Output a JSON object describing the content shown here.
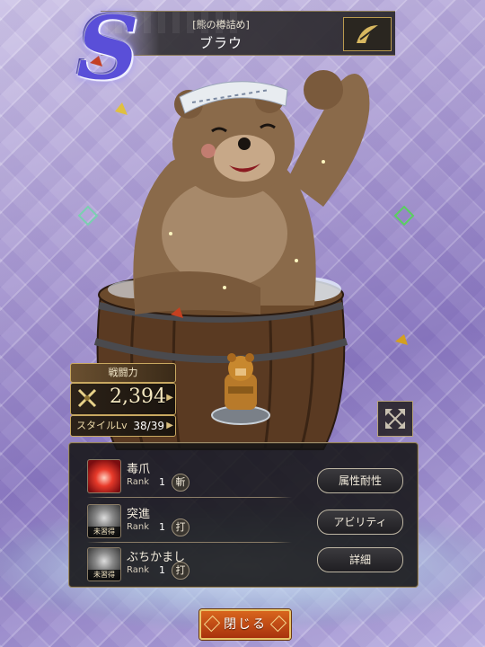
{
  "header": {
    "style_title": "[熊の樽詰め]",
    "character_name": "ブラウ",
    "rank_logo": "S"
  },
  "stats": {
    "power_label": "戦闘力",
    "power_value": "2,394",
    "style_lv_label": "スタイルLv",
    "style_lv_value": "38/39"
  },
  "skills": [
    {
      "name": "毒爪",
      "rank_label": "Rank",
      "rank": "1",
      "type": "斬",
      "learned": true,
      "icon": "claw-icon",
      "unlearned_label": ""
    },
    {
      "name": "突進",
      "rank_label": "Rank",
      "rank": "1",
      "type": "打",
      "learned": false,
      "icon": "charge-icon",
      "unlearned_label": "未習得"
    },
    {
      "name": "ぶちかまし",
      "rank_label": "Rank",
      "rank": "1",
      "type": "打",
      "learned": false,
      "icon": "bash-icon",
      "unlearned_label": "未習得"
    }
  ],
  "side_buttons": {
    "resist": "属性耐性",
    "ability": "アビリティ",
    "detail": "詳細"
  },
  "close_button": "閉じる",
  "colors": {
    "accent_gold": "#c8a860",
    "close_orange": "#d8651d",
    "background_purple": "#a99ad2"
  }
}
